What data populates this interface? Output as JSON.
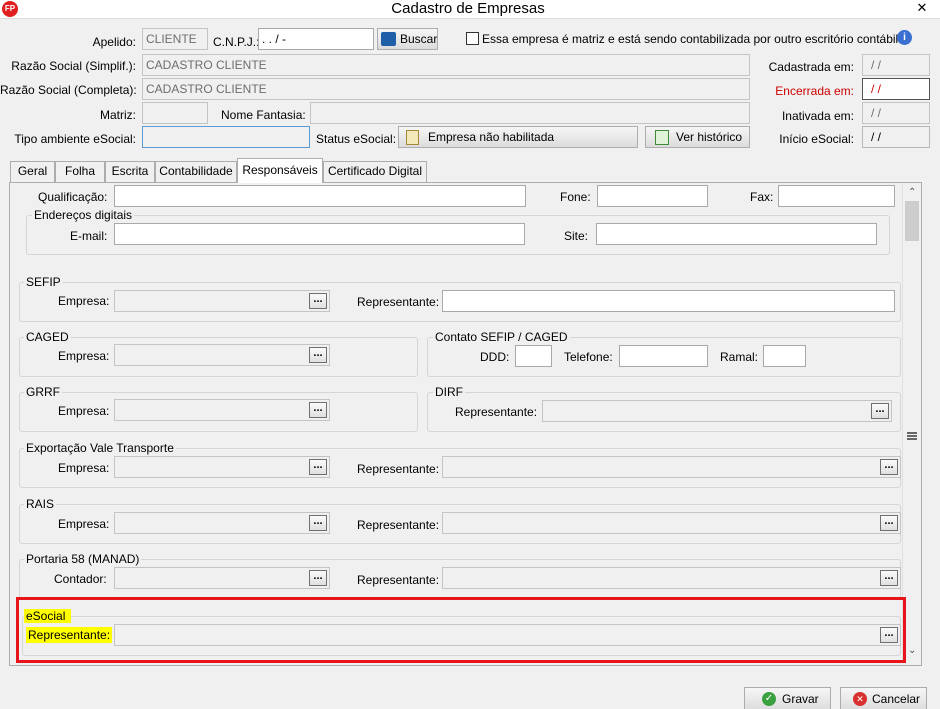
{
  "window": {
    "title": "Cadastro de Empresas",
    "app_icon": "FP",
    "close_icon": "✕"
  },
  "top": {
    "apelido_label": "Apelido:",
    "apelido_value": "CLIENTE",
    "cnpj_label": "C.N.P.J.:",
    "cnpj_value": " .   .   /    -",
    "buscar_label": "Buscar",
    "matriz_checkbox_label": "Essa empresa é matriz e está sendo contabilizada por outro escritório contábil",
    "razao_simpl_label": "Razão Social (Simplif.):",
    "razao_simpl_value": "CADASTRO CLIENTE",
    "razao_comp_label": "Razão Social (Completa):",
    "razao_comp_value": "CADASTRO CLIENTE",
    "matriz_label": "Matriz:",
    "nome_fantasia_label": "Nome Fantasia:",
    "tipo_ambiente_label": "Tipo ambiente eSocial:",
    "status_esocial_label": "Status eSocial:",
    "status_esocial_value": "Empresa não habilitada",
    "ver_historico_label": "Ver histórico"
  },
  "dates": {
    "cadastrada_label": "Cadastrada em:",
    "cadastrada_value": "/ /",
    "encerrada_label": "Encerrada em:",
    "encerrada_value": "/ /",
    "inativada_label": "Inativada em:",
    "inativada_value": "/ /",
    "inicio_label": "Início eSocial:",
    "inicio_value": "/ /",
    "encerrada_color": "#cc0000"
  },
  "tabs": [
    {
      "label": "Geral"
    },
    {
      "label": "Folha"
    },
    {
      "label": "Escrita"
    },
    {
      "label": "Contabilidade"
    },
    {
      "label": "Responsáveis"
    },
    {
      "label": "Certificado Digital"
    }
  ],
  "panel": {
    "qualificacao_label": "Qualificação:",
    "fone_label": "Fone:",
    "fax_label": "Fax:",
    "enderecos_title": "Endereços digitais",
    "email_label": "E-mail:",
    "site_label": "Site:",
    "sefip_title": "SEFIP",
    "empresa_label": "Empresa:",
    "representante_label": "Representante:",
    "caged_title": "CAGED",
    "contato_title": "Contato SEFIP / CAGED",
    "ddd_label": "DDD:",
    "telefone_label": "Telefone:",
    "ramal_label": "Ramal:",
    "grrf_title": "GRRF",
    "dirf_title": "DIRF",
    "vale_title": "Exportação Vale Transporte",
    "rais_title": "RAIS",
    "portaria_title": "Portaria 58 (MANAD)",
    "contador_label": "Contador:",
    "esocial_title": "eSocial",
    "esocial_rep_label": "Representante:",
    "ellipsis": "...",
    "highlight_color": "#e8141c"
  },
  "footer": {
    "gravar_label": "Gravar",
    "cancelar_label": "Cancelar"
  }
}
